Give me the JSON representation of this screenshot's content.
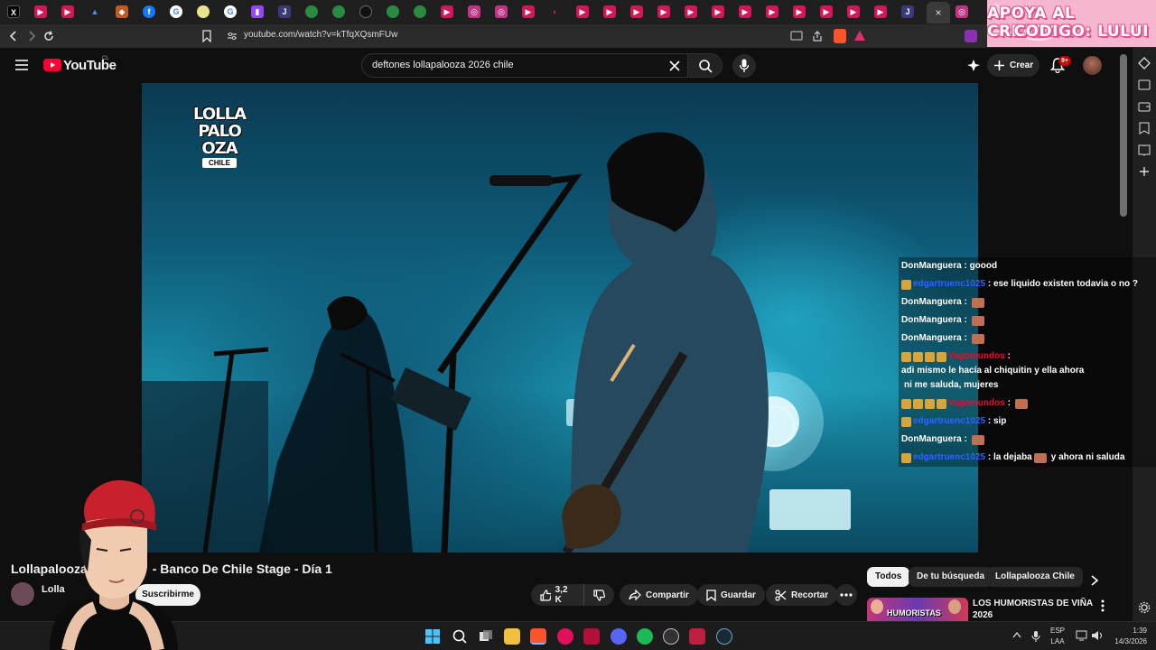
{
  "browser": {
    "url": "youtube.com/watch?v=kTfqXQsmFUw",
    "tab_close": "×"
  },
  "promo": {
    "line1": "APOYA AL CREADOR",
    "line2": "CODIGO: LULUI"
  },
  "youtube": {
    "logo_text": "YouTube",
    "country": "CL",
    "search_value": "deftones lollapalooza 2026 chile",
    "create_label": "Crear",
    "notif_count": "9+"
  },
  "video": {
    "logo_line1": "LOLLA",
    "logo_line2": "PALO",
    "logo_line3": "OZA",
    "logo_chile": "CHILE",
    "title": "Lollapalooza Chile 2026 - Banco De Chile Stage - Día 1",
    "title_visible_left": "Lollapalooza ",
    "title_visible_right": "- Banco De Chile Stage - Día 1",
    "channel": "Lollapalooza Chile",
    "channel_visible": "Lolla",
    "subscribe": "Suscribirme",
    "likes": "3,2 K",
    "share": "Compartir",
    "save": "Guardar",
    "clip": "Recortar"
  },
  "chat": [
    {
      "name": "DonManguera",
      "sep": " : ",
      "text": "goood",
      "color": "white",
      "badges": 0
    },
    {
      "name": "edgartruenc1025",
      "sep": " : ",
      "text": "ese liquido existen todavia o no ?",
      "color": "blue",
      "badges": 1
    },
    {
      "name": "DonManguera",
      "sep": " : ",
      "text": "",
      "color": "white",
      "badges": 0,
      "emote": true
    },
    {
      "name": "DonManguera",
      "sep": " : ",
      "text": "",
      "color": "white",
      "badges": 0,
      "emote": true
    },
    {
      "name": "DonManguera",
      "sep": " : ",
      "text": "",
      "color": "white",
      "badges": 0,
      "emote": true
    },
    {
      "name": "Vagomundos",
      "sep": " : ",
      "text": "adi mismo le hacía al chiquitin y ella ahora",
      "text2": "ni me saluda, mujeres",
      "color": "red",
      "badges": 4
    },
    {
      "name": "Vagomundos",
      "sep": " : ",
      "text": "",
      "color": "red",
      "badges": 4,
      "emote": true
    },
    {
      "name": "edgartruenc1025",
      "sep": " : ",
      "text": "sip",
      "color": "blue",
      "badges": 1
    },
    {
      "name": "DonManguera",
      "sep": " : ",
      "text": "",
      "color": "white",
      "badges": 0,
      "emote": true
    },
    {
      "name": "edgartruenc1025",
      "sep": " : ",
      "text": "la dejaba",
      "text2": "y ahora ni saluda",
      "color": "blue",
      "badges": 1,
      "emote": true
    }
  ],
  "chips": [
    "Todos",
    "De tu búsqueda",
    "Lollapalooza Chile"
  ],
  "recommended": {
    "title": "LOS HUMORISTAS DE VIÑA 2026",
    "thumb_text": "HUMORISTAS"
  },
  "taskbar": {
    "lang_line1": "ESP",
    "lang_line2": "LAA",
    "time": "1:39",
    "date": "14/3/2026"
  },
  "colors": {
    "youtube_red": "#ff0033",
    "bg": "#0f0f0f",
    "promo_pink": "#f6b6cf"
  }
}
